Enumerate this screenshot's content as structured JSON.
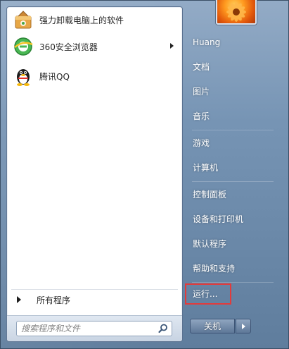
{
  "pinned_programs": [
    {
      "label": "强力卸载电脑上的软件",
      "icon": "uninstall-box-icon"
    },
    {
      "label": "360安全浏览器",
      "icon": "browser-360-icon"
    },
    {
      "label": "腾讯QQ",
      "icon": "qq-penguin-icon"
    }
  ],
  "all_programs_label": "所有程序",
  "search": {
    "placeholder": "搜索程序和文件"
  },
  "right_items": [
    "Huang",
    "文档",
    "图片",
    "音乐",
    "游戏",
    "计算机",
    "控制面板",
    "设备和打印机",
    "默认程序",
    "帮助和支持",
    "运行..."
  ],
  "shutdown_label": "关机",
  "colors": {
    "highlight": "#e23b3b",
    "panel": "#ffffff",
    "sidebar": "#6f8aa8"
  }
}
